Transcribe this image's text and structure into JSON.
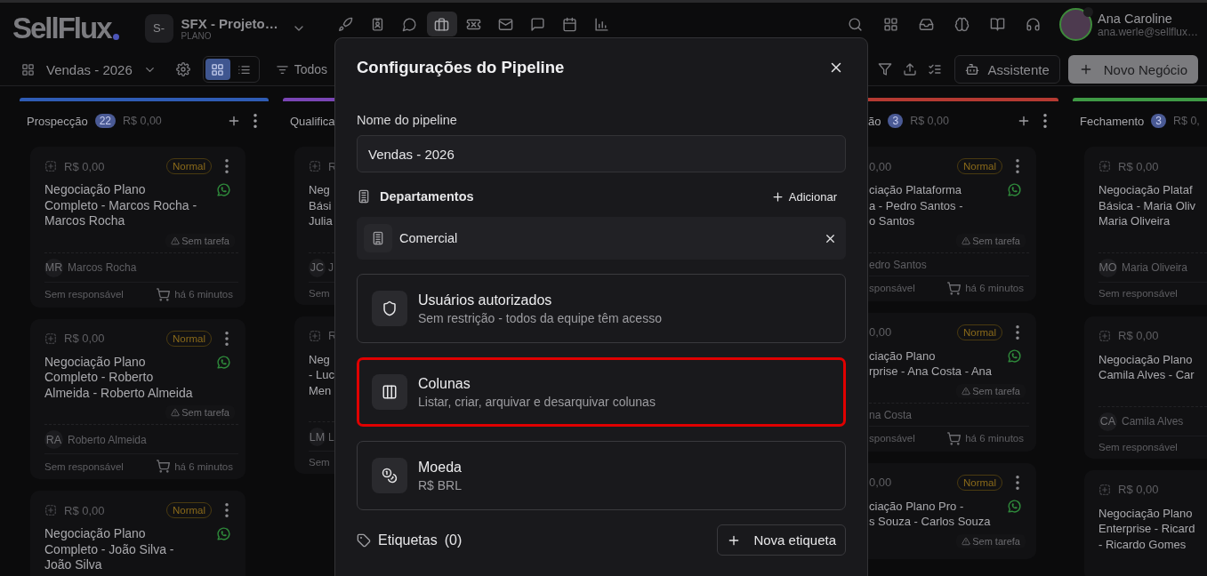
{
  "topbar": {
    "logo": "SellFlux",
    "workspace": {
      "initials": "S-",
      "name": "SFX - Projeto…",
      "plan": "PLANO"
    },
    "nav": [
      {
        "selected": false
      },
      {
        "selected": false
      },
      {
        "selected": false
      },
      {
        "selected": true
      },
      {
        "selected": false
      },
      {
        "selected": false
      },
      {
        "selected": false
      },
      {
        "selected": false
      },
      {
        "selected": false
      }
    ],
    "user": {
      "name": "Ana Caroline",
      "email": "ana.werle@sellflux…"
    }
  },
  "toolbar": {
    "pipeline": "Vendas - 2026",
    "views": [
      {
        "selected": true
      },
      {
        "selected": false
      }
    ],
    "filter": "Todos",
    "assistant": "Assistente",
    "new_deal": "Novo Negócio"
  },
  "board": {
    "columns": [
      {
        "kind": "full",
        "name": "Prospecção",
        "color": "#2f5cb5",
        "count": "22",
        "total": "R$ 0,00",
        "cards": [
          {
            "value": "R$ 0,00",
            "priority": "Normal",
            "whatsapp": true,
            "title": [
              "Negociação Plano",
              "Completo - Marcos Rocha -",
              "Marcos Rocha"
            ],
            "task": "Sem tarefa",
            "initials": "MR",
            "contact": "Marcos Rocha",
            "owner": "Sem responsável",
            "time": "há 6 minutos"
          },
          {
            "value": "R$ 0,00",
            "priority": "Normal",
            "whatsapp": true,
            "title": [
              "Negociação Plano",
              "Completo - Roberto",
              "Almeida - Roberto Almeida"
            ],
            "task": "Sem tarefa",
            "initials": "RA",
            "contact": "Roberto Almeida",
            "owner": "Sem responsável",
            "time": "há 6 minutos"
          },
          {
            "value": "R$ 0,00",
            "priority": "Normal",
            "whatsapp": true,
            "title": [
              "Negociação Plano",
              "Completo - João Silva -",
              "João Silva"
            ]
          }
        ]
      },
      {
        "kind": "cut_right",
        "name": "Qualifica",
        "color": "#7a45b5",
        "cards": [
          {
            "value": "R",
            "title": [
              "Neg",
              "Bási",
              "Julia"
            ],
            "initials": "JC",
            "contact": "J",
            "owner": "Sem"
          },
          {
            "value": "R",
            "title": [
              "Neg",
              "- Luc",
              "Men"
            ],
            "initials": "LM",
            "contact": "L",
            "owner": "Sem"
          }
        ]
      },
      {
        "kind": "cut_left",
        "name": "ão",
        "color": "#b53a32",
        "count": "3",
        "total": "R$ 0,00",
        "cards": [
          {
            "value": "0,00",
            "priority": "Normal",
            "whatsapp": true,
            "title": [
              "ciação Plataforma",
              "a - Pedro Santos -",
              "o Santos"
            ],
            "task": "Sem tarefa",
            "contact": "edro Santos",
            "owner": "sponsável",
            "time": "há 6 minutos"
          },
          {
            "value": "0,00",
            "priority": "Normal",
            "whatsapp": true,
            "title": [
              "ciação Plano",
              "rprise - Ana Costa - Ana"
            ],
            "task": "Sem tarefa",
            "contact": "na Costa",
            "owner": "sponsável",
            "time": "há 6 minutos"
          },
          {
            "value": "0,00",
            "priority": "Normal",
            "whatsapp": true,
            "title": [
              "ciação Plano Pro -",
              "s Souza - Carlos Souza"
            ],
            "task": "Sem tarefa"
          }
        ]
      },
      {
        "kind": "cut_right",
        "name": "Fechamento",
        "color": "#3f9a45",
        "count": "3",
        "total": "R$ 0,",
        "cards": [
          {
            "value": "R$ 0,00",
            "title": [
              "Negociação Plataf",
              "Básica - Maria Oliv",
              "Maria Oliveira"
            ],
            "initials": "MO",
            "contact": "Maria Oliveira",
            "owner": "Sem responsável"
          },
          {
            "value": "R$ 0,00",
            "title": [
              "Negociação Plano",
              "Camila Alves - Car"
            ],
            "initials": "CA",
            "contact": "Camila Alves",
            "owner": "Sem responsável"
          },
          {
            "value": "R$ 0,00",
            "title": [
              "Negociação Plano",
              "Enterprise - Ricard",
              "- Ricardo Gomes"
            ]
          }
        ]
      }
    ]
  },
  "modal": {
    "title": "Configurações do Pipeline",
    "name_label": "Nome do pipeline",
    "name_value": "Vendas - 2026",
    "departments_label": "Departamentos",
    "add_label": "Adicionar",
    "departments": [
      "Comercial"
    ],
    "settings": [
      {
        "kind": "users",
        "title": "Usuários autorizados",
        "subtitle": "Sem restrição - todos da equipe têm acesso",
        "highlighted": false
      },
      {
        "kind": "columns",
        "title": "Colunas",
        "subtitle": "Listar, criar, arquivar e desarquivar colunas",
        "highlighted": true
      },
      {
        "kind": "currency",
        "title": "Moeda",
        "subtitle": "R$ BRL",
        "highlighted": false
      }
    ],
    "tags_label": "Etiquetas",
    "tags_count": "(0)",
    "new_tag": "Nova etiqueta"
  }
}
